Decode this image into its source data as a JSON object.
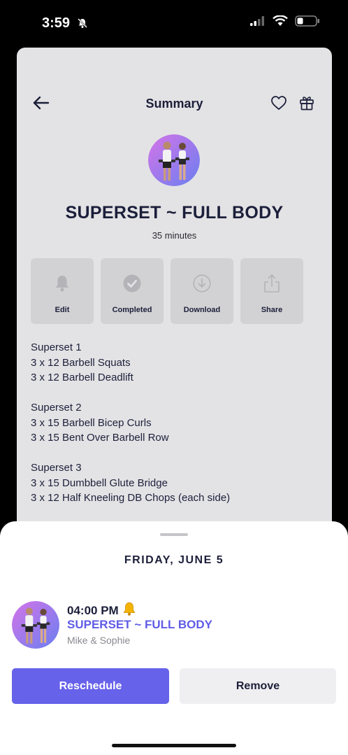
{
  "status_bar": {
    "time": "3:59"
  },
  "card": {
    "title": "Summary",
    "workout_title": "SUPERSET ~ FULL BODY",
    "duration": "35 minutes",
    "actions": [
      {
        "label": "Edit",
        "icon": "bell-icon"
      },
      {
        "label": "Completed",
        "icon": "check-circle-icon"
      },
      {
        "label": "Download",
        "icon": "download-icon"
      },
      {
        "label": "Share",
        "icon": "share-icon"
      }
    ],
    "exercise_groups": [
      {
        "name": "Superset 1",
        "items": [
          "3 x 12 Barbell Squats",
          "3 x 12 Barbell Deadlift"
        ]
      },
      {
        "name": "Superset 2",
        "items": [
          "3 x 15 Barbell Bicep Curls",
          "3 x 15 Bent Over Barbell Row"
        ]
      },
      {
        "name": "Superset 3",
        "items": [
          "3 x 15 Dumbbell Glute Bridge",
          "3 x 12 Half Kneeling DB Chops (each side)"
        ]
      }
    ]
  },
  "sheet": {
    "date": "FRIDAY, JUNE 5",
    "event_time": "04:00 PM",
    "event_title": "SUPERSET ~ FULL BODY",
    "event_sub": "Mike & Sophie",
    "reschedule_label": "Reschedule",
    "remove_label": "Remove"
  },
  "colors": {
    "accent": "#6762ea",
    "dark_text": "#1c1f3a",
    "card_bg": "#e3e3e5"
  }
}
